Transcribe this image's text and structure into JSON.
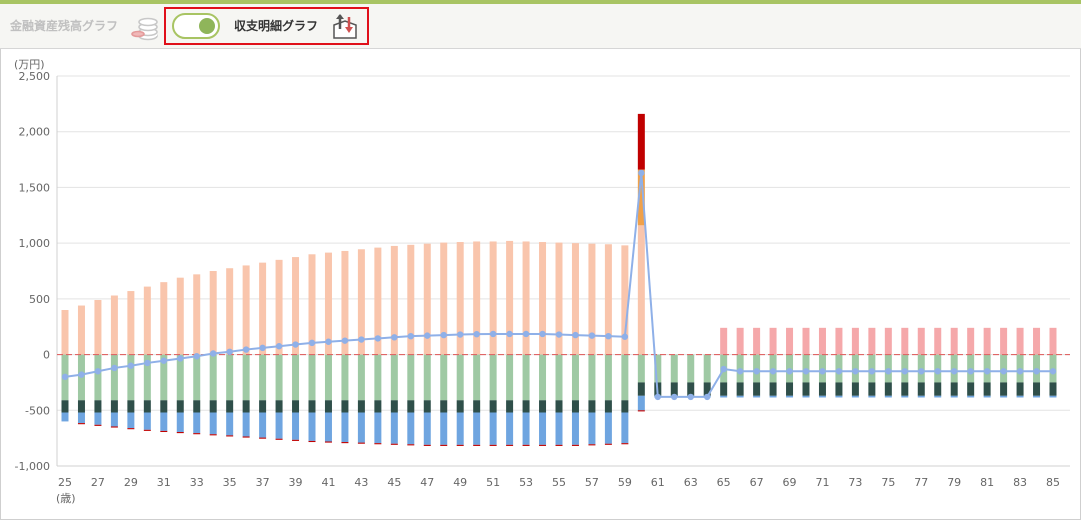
{
  "header": {
    "tab_balance_label": "金融資産残高グラフ",
    "tab_detail_label": "収支明細グラフ",
    "toggle_state": "on",
    "icons": {
      "balance": "coins-stack-icon",
      "detail": "income-expense-arrows-icon"
    }
  },
  "colors": {
    "income": "#f9c5ac",
    "income_special": "#f0a14a",
    "income_peak": "#c00000",
    "pension": "#f5a8aa",
    "living_cost": "#9fc9a4",
    "housing": "#2f4f4a",
    "other_cost": "#6fa5e0",
    "small_cost": "#c00000",
    "balance_line": "#8fb0e8",
    "zero_line": "#e06666"
  },
  "chart_data": {
    "type": "bar",
    "yunit": "(万円)",
    "xunit": "(歳)",
    "ylim": [
      -1000,
      2500
    ],
    "yticks": [
      -1000,
      -500,
      0,
      500,
      1000,
      1500,
      2000,
      2500
    ],
    "ytick_labels": [
      "-1,000",
      "-500",
      "0",
      "500",
      "1,000",
      "1,500",
      "2,000",
      "2,500"
    ],
    "xticks": [
      "25",
      "27",
      "29",
      "31",
      "33",
      "35",
      "37",
      "39",
      "41",
      "43",
      "45",
      "47",
      "49",
      "51",
      "53",
      "55",
      "57",
      "59",
      "61",
      "63",
      "65",
      "67",
      "69",
      "71",
      "73",
      "75",
      "77",
      "79",
      "81",
      "83",
      "85"
    ],
    "ages": [
      25,
      26,
      27,
      28,
      29,
      30,
      31,
      32,
      33,
      34,
      35,
      36,
      37,
      38,
      39,
      40,
      41,
      42,
      43,
      44,
      45,
      46,
      47,
      48,
      49,
      50,
      51,
      52,
      53,
      54,
      55,
      56,
      57,
      58,
      59,
      60,
      61,
      62,
      63,
      64,
      65,
      66,
      67,
      68,
      69,
      70,
      71,
      72,
      73,
      74,
      75,
      76,
      77,
      78,
      79,
      80,
      81,
      82,
      83,
      84,
      85
    ],
    "series": [
      {
        "key": "income",
        "values": [
          400,
          440,
          490,
          530,
          570,
          610,
          650,
          690,
          720,
          750,
          775,
          800,
          825,
          850,
          875,
          900,
          915,
          930,
          945,
          960,
          975,
          985,
          995,
          1005,
          1010,
          1015,
          1015,
          1020,
          1015,
          1010,
          1005,
          1000,
          995,
          990,
          980,
          1160,
          0,
          0,
          0,
          0,
          0,
          0,
          0,
          0,
          0,
          0,
          0,
          0,
          0,
          0,
          0,
          0,
          0,
          0,
          0,
          0,
          0,
          0,
          0,
          0,
          0
        ]
      },
      {
        "key": "income_special",
        "values": [
          0,
          0,
          0,
          0,
          0,
          0,
          0,
          0,
          0,
          0,
          0,
          0,
          0,
          0,
          0,
          0,
          0,
          0,
          0,
          0,
          0,
          0,
          0,
          0,
          0,
          0,
          0,
          0,
          0,
          0,
          0,
          0,
          0,
          0,
          0,
          500,
          0,
          0,
          0,
          0,
          0,
          0,
          0,
          0,
          0,
          0,
          0,
          0,
          0,
          0,
          0,
          0,
          0,
          0,
          0,
          0,
          0,
          0,
          0,
          0,
          0
        ]
      },
      {
        "key": "income_peak",
        "values": [
          0,
          0,
          0,
          0,
          0,
          0,
          0,
          0,
          0,
          0,
          0,
          0,
          0,
          0,
          0,
          0,
          0,
          0,
          0,
          0,
          0,
          0,
          0,
          0,
          0,
          0,
          0,
          0,
          0,
          0,
          0,
          0,
          0,
          0,
          0,
          500,
          0,
          0,
          0,
          0,
          0,
          0,
          0,
          0,
          0,
          0,
          0,
          0,
          0,
          0,
          0,
          0,
          0,
          0,
          0,
          0,
          0,
          0,
          0,
          0,
          0
        ]
      },
      {
        "key": "pension",
        "values": [
          0,
          0,
          0,
          0,
          0,
          0,
          0,
          0,
          0,
          0,
          0,
          0,
          0,
          0,
          0,
          0,
          0,
          0,
          0,
          0,
          0,
          0,
          0,
          0,
          0,
          0,
          0,
          0,
          0,
          0,
          0,
          0,
          0,
          0,
          0,
          0,
          0,
          0,
          0,
          0,
          240,
          240,
          240,
          240,
          240,
          240,
          240,
          240,
          240,
          240,
          240,
          240,
          240,
          240,
          240,
          240,
          240,
          240,
          240,
          240,
          240
        ]
      },
      {
        "key": "living_cost",
        "values": [
          -410,
          -410,
          -410,
          -410,
          -410,
          -410,
          -410,
          -410,
          -410,
          -410,
          -410,
          -410,
          -410,
          -410,
          -410,
          -410,
          -410,
          -410,
          -410,
          -410,
          -410,
          -410,
          -410,
          -410,
          -410,
          -410,
          -410,
          -410,
          -410,
          -410,
          -410,
          -410,
          -410,
          -410,
          -410,
          -250,
          -250,
          -250,
          -250,
          -250,
          -250,
          -250,
          -250,
          -250,
          -250,
          -250,
          -250,
          -250,
          -250,
          -250,
          -250,
          -250,
          -250,
          -250,
          -250,
          -250,
          -250,
          -250,
          -250,
          -250,
          -250
        ]
      },
      {
        "key": "housing",
        "values": [
          -110,
          -110,
          -110,
          -110,
          -110,
          -110,
          -110,
          -110,
          -110,
          -110,
          -110,
          -110,
          -110,
          -110,
          -110,
          -110,
          -110,
          -110,
          -110,
          -110,
          -110,
          -110,
          -110,
          -110,
          -110,
          -110,
          -110,
          -110,
          -110,
          -110,
          -110,
          -110,
          -110,
          -110,
          -110,
          -120,
          -120,
          -120,
          -120,
          -120,
          -120,
          -120,
          -120,
          -120,
          -120,
          -120,
          -120,
          -120,
          -120,
          -120,
          -120,
          -120,
          -120,
          -120,
          -120,
          -120,
          -120,
          -120,
          -120,
          -120,
          -120
        ]
      },
      {
        "key": "other_cost",
        "values": [
          -80,
          -95,
          -110,
          -125,
          -140,
          -155,
          -165,
          -175,
          -185,
          -195,
          -205,
          -215,
          -225,
          -235,
          -245,
          -255,
          -260,
          -265,
          -270,
          -275,
          -280,
          -285,
          -290,
          -290,
          -290,
          -290,
          -290,
          -290,
          -290,
          -290,
          -290,
          -290,
          -285,
          -280,
          -275,
          -130,
          -15,
          -15,
          -15,
          -15,
          -15,
          -15,
          -15,
          -15,
          -15,
          -15,
          -15,
          -15,
          -15,
          -15,
          -15,
          -15,
          -15,
          -15,
          -15,
          -15,
          -15,
          -15,
          -15,
          -15,
          -15
        ]
      },
      {
        "key": "small_cost",
        "values": [
          0,
          -10,
          -10,
          -10,
          -10,
          -10,
          -10,
          -10,
          -10,
          -10,
          -10,
          -10,
          -10,
          -10,
          -10,
          -10,
          -10,
          -10,
          -10,
          -10,
          -10,
          -10,
          -10,
          -10,
          -10,
          -10,
          -10,
          -10,
          -10,
          -10,
          -10,
          -10,
          -10,
          -10,
          -10,
          -10,
          0,
          0,
          0,
          0,
          0,
          0,
          0,
          0,
          0,
          0,
          0,
          0,
          0,
          0,
          0,
          0,
          0,
          0,
          0,
          0,
          0,
          0,
          0,
          0,
          0
        ]
      }
    ],
    "line": {
      "key": "balance_line",
      "values": [
        -200,
        -180,
        -150,
        -120,
        -100,
        -75,
        -55,
        -35,
        -15,
        10,
        25,
        45,
        60,
        75,
        90,
        105,
        115,
        125,
        135,
        145,
        155,
        165,
        170,
        175,
        180,
        183,
        185,
        185,
        185,
        185,
        180,
        175,
        170,
        165,
        160,
        1630,
        -380,
        -380,
        -380,
        -380,
        -130,
        -150,
        -150,
        -150,
        -150,
        -150,
        -150,
        -150,
        -150,
        -150,
        -150,
        -150,
        -150,
        -150,
        -150,
        -150,
        -150,
        -150,
        -150,
        -150,
        -150
      ]
    }
  }
}
